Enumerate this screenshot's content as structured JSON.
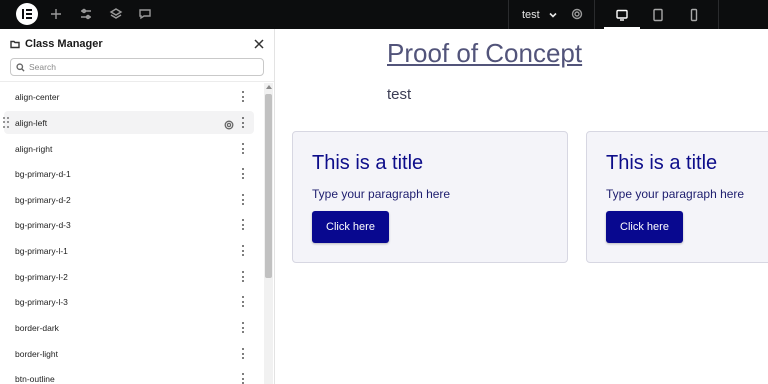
{
  "topbar": {
    "page_name": "test",
    "icons": [
      "elementor-logo-icon",
      "add-icon",
      "sliders-icon",
      "layers-icon",
      "comments-icon",
      "page-settings-icon"
    ],
    "devices": [
      {
        "name": "desktop-icon",
        "active": true
      },
      {
        "name": "tablet-icon",
        "active": false
      },
      {
        "name": "mobile-icon",
        "active": false
      }
    ]
  },
  "panel": {
    "title": "Class Manager",
    "search_placeholder": "Search",
    "classes": [
      {
        "label": "align-center"
      },
      {
        "label": "align-left",
        "hover": true
      },
      {
        "label": "align-right"
      },
      {
        "label": "bg-primary-d-1"
      },
      {
        "label": "bg-primary-d-2"
      },
      {
        "label": "bg-primary-d-3"
      },
      {
        "label": "bg-primary-l-1"
      },
      {
        "label": "bg-primary-l-2"
      },
      {
        "label": "bg-primary-l-3"
      },
      {
        "label": "border-dark"
      },
      {
        "label": "border-light"
      },
      {
        "label": "btn-outline"
      }
    ]
  },
  "canvas": {
    "heading": "Proof of Concept",
    "subheading": "test",
    "cards": [
      {
        "title": "This is a title",
        "text": "Type your paragraph here",
        "button": "Click here"
      },
      {
        "title": "This is a title",
        "text": "Type your paragraph here",
        "button": "Click here"
      }
    ]
  },
  "colors": {
    "topbar_bg": "#0c0d0e",
    "heading": "#52547a",
    "card_title": "#0d0d8a",
    "button_bg": "#08088f",
    "card_bg": "#f4f4f9"
  }
}
